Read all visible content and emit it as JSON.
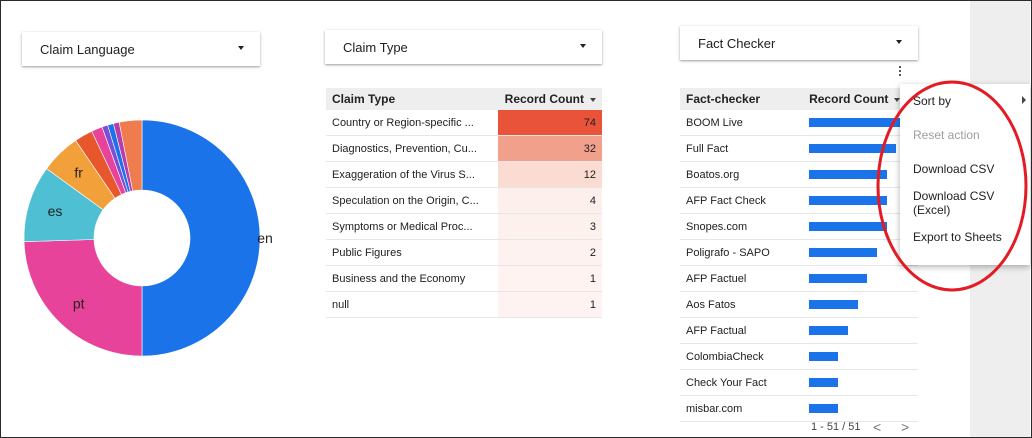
{
  "filters": {
    "claim_language": "Claim Language",
    "claim_type": "Claim Type",
    "fact_checker": "Fact Checker"
  },
  "pie": {
    "labels": {
      "en": "en",
      "pt": "pt",
      "es": "es",
      "fr": "fr"
    },
    "slices": [
      {
        "label": "en",
        "value": 50.0,
        "color": "#1a73e8"
      },
      {
        "label": "pt",
        "value": 24.5,
        "color": "#e8439a"
      },
      {
        "label": "es",
        "value": 10.5,
        "color": "#4fbfd4"
      },
      {
        "label": "fr",
        "value": 5.5,
        "color": "#f2a13a"
      },
      {
        "label": "",
        "value": 2.5,
        "color": "#e8572c"
      },
      {
        "label": "",
        "value": 1.5,
        "color": "#e8439a"
      },
      {
        "label": "",
        "value": 0.8,
        "color": "#7b4ed8"
      },
      {
        "label": "",
        "value": 0.8,
        "color": "#1a73e8"
      },
      {
        "label": "",
        "value": 0.8,
        "color": "#b83bb0"
      },
      {
        "label": "",
        "value": 3.1,
        "color": "#ef7c4f"
      }
    ]
  },
  "claim_table": {
    "headers": {
      "name": "Claim Type",
      "count": "Record Count"
    },
    "rows": [
      {
        "name": "Country or Region-specific ...",
        "count": "74",
        "bg": "#e8533a"
      },
      {
        "name": "Diagnostics, Prevention, Cu...",
        "count": "32",
        "bg": "#f1a08c"
      },
      {
        "name": "Exaggeration of the Virus S...",
        "count": "12",
        "bg": "#fadcd3"
      },
      {
        "name": "Speculation on the Origin, C...",
        "count": "4",
        "bg": "#fdf0ec"
      },
      {
        "name": "Symptoms or Medical Proc...",
        "count": "3",
        "bg": "#fdf1ee"
      },
      {
        "name": "Public Figures",
        "count": "2",
        "bg": "#fdf2ef"
      },
      {
        "name": "Business and the Economy",
        "count": "1",
        "bg": "#fef3f0"
      },
      {
        "name": "null",
        "count": "1",
        "bg": "#fef3f0"
      }
    ]
  },
  "fc_table": {
    "headers": {
      "name": "Fact-checker",
      "count": "Record Count"
    },
    "rows": [
      {
        "name": "BOOM Live",
        "bar": 1.0
      },
      {
        "name": "Full Fact",
        "bar": 0.87
      },
      {
        "name": "Boatos.org",
        "bar": 0.78
      },
      {
        "name": "AFP Fact Check",
        "bar": 0.78
      },
      {
        "name": "Snopes.com",
        "bar": 0.78
      },
      {
        "name": "Poligrafo - SAPO",
        "bar": 0.68
      },
      {
        "name": "AFP Factuel",
        "bar": 0.58
      },
      {
        "name": "Aos Fatos",
        "bar": 0.49
      },
      {
        "name": "AFP Factual",
        "bar": 0.39
      },
      {
        "name": "ColombiaCheck",
        "bar": 0.29
      },
      {
        "name": "Check Your Fact",
        "bar": 0.29
      },
      {
        "name": "misbar.com",
        "bar": 0.29
      }
    ],
    "pager": "1 - 51 / 51",
    "prev": "<",
    "next": ">"
  },
  "menu": {
    "sort_by": "Sort by",
    "reset": "Reset action",
    "csv": "Download CSV",
    "csv_excel": "Download CSV (Excel)",
    "sheets": "Export to Sheets"
  },
  "colors": {
    "highlight": "#e31b23",
    "bar": "#1a73e8"
  }
}
